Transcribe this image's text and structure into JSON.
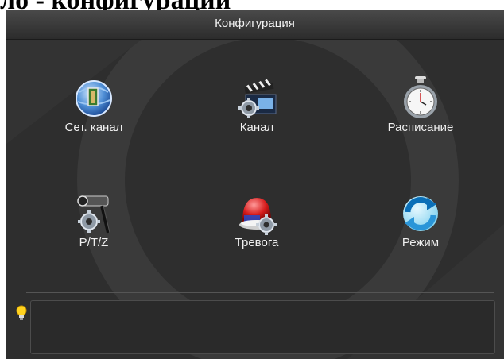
{
  "heading": "ло - конфигурации",
  "window": {
    "title": "Конфигурация"
  },
  "tiles": [
    {
      "label": "Сет. канал",
      "icon": "network-icon"
    },
    {
      "label": "Канал",
      "icon": "channel-clapper-icon"
    },
    {
      "label": "Расписание",
      "icon": "stopwatch-icon"
    },
    {
      "label": "P/T/Z",
      "icon": "ptz-camera-icon"
    },
    {
      "label": "Тревога",
      "icon": "alarm-siren-icon"
    },
    {
      "label": "Режим",
      "icon": "refresh-mode-icon"
    }
  ],
  "hint": {
    "icon": "lightbulb-icon",
    "text": ""
  }
}
